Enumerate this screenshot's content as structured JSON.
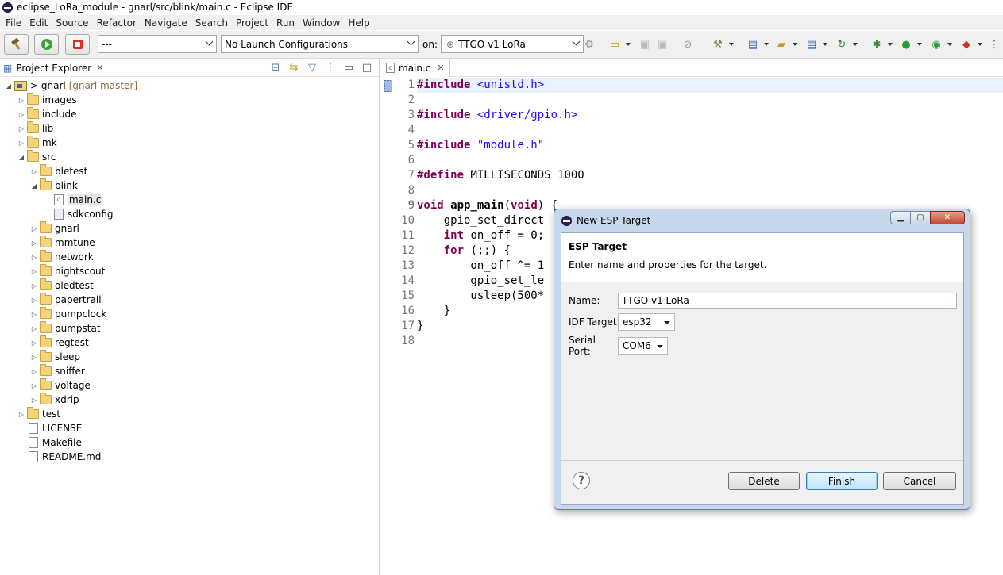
{
  "window": {
    "title": "eclipse_LoRa_module - gnarl/src/blink/main.c - Eclipse IDE"
  },
  "menu": [
    "File",
    "Edit",
    "Source",
    "Refactor",
    "Navigate",
    "Search",
    "Project",
    "Run",
    "Window",
    "Help"
  ],
  "toolbar": {
    "launch_mode": "---",
    "launch_config": "No Launch Configurations",
    "on_label": "on:",
    "launch_target": "TTGO v1 LoRa"
  },
  "explorer": {
    "tab_label": "Project Explorer",
    "project_name": "> gnarl",
    "project_branch": "[gnarl master]",
    "top_folders": [
      "images",
      "include",
      "lib",
      "mk"
    ],
    "src_label": "src",
    "src_before_blink": [
      "bletest"
    ],
    "blink_label": "blink",
    "blink_files": [
      "main.c",
      "sdkconfig"
    ],
    "src_after_blink": [
      "gnarl",
      "mmtune",
      "network",
      "nightscout",
      "oledtest",
      "papertrail",
      "pumpclock",
      "pumpstat",
      "regtest",
      "sleep",
      "sniffer",
      "voltage",
      "xdrip"
    ],
    "test_label": "test",
    "root_files": [
      "LICENSE",
      "Makefile",
      "README.md"
    ]
  },
  "editor": {
    "tab_label": "main.c",
    "line_numbers": [
      "1",
      "2",
      "3",
      "4",
      "5",
      "6",
      "7",
      "8",
      "9",
      "10",
      "11",
      "12",
      "13",
      "14",
      "15",
      "16",
      "17",
      "18"
    ]
  },
  "dialog": {
    "title": "New ESP Target",
    "heading": "ESP Target",
    "description": "Enter name and properties for the target.",
    "name_label": "Name:",
    "name_value": "TTGO v1 LoRa",
    "idf_label": "IDF Target",
    "idf_value": "esp32",
    "serial_label": "Serial Port:",
    "serial_value": "COM6",
    "delete_label": "Delete",
    "finish_label": "Finish",
    "cancel_label": "Cancel",
    "help_glyph": "?"
  }
}
